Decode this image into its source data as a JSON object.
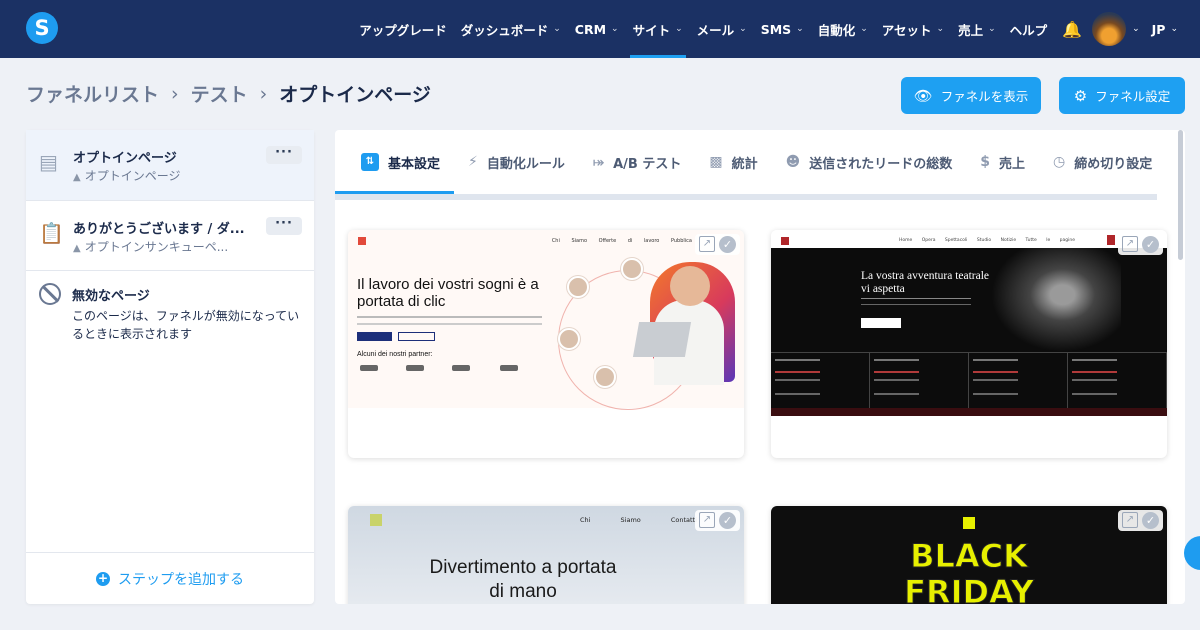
{
  "nav": {
    "items": [
      {
        "label": "アップグレード",
        "chevron": false
      },
      {
        "label": "ダッシュボード",
        "chevron": true
      },
      {
        "label": "CRM",
        "chevron": true
      },
      {
        "label": "サイト",
        "chevron": true,
        "active": true
      },
      {
        "label": "メール",
        "chevron": true
      },
      {
        "label": "SMS",
        "chevron": true
      },
      {
        "label": "自動化",
        "chevron": true
      },
      {
        "label": "アセット",
        "chevron": true
      },
      {
        "label": "売上",
        "chevron": true
      },
      {
        "label": "ヘルプ",
        "chevron": false
      }
    ],
    "logo_letter": "S",
    "language": "JP"
  },
  "breadcrumb": {
    "funnel_list": "ファネルリスト",
    "test": "テスト",
    "current": "オプトインページ"
  },
  "buttons": {
    "view_funnel": "ファネルを表示",
    "funnel_settings": "ファネル設定"
  },
  "sidebar": {
    "steps": [
      {
        "title": "オプトインページ",
        "subtitle": "オプトインページ"
      },
      {
        "title": "ありがとうございます / ダ...",
        "subtitle": "オプトインサンキューペ..."
      }
    ],
    "inactive": {
      "title": "無効なページ",
      "description": "このページは、ファネルが無効になっているときに表示されます"
    },
    "add_step": "ステップを追加する"
  },
  "tabs": [
    {
      "label": "基本設定",
      "icon": "sliders-icon",
      "active": true
    },
    {
      "label": "自動化ルール",
      "icon": "bolt-icon"
    },
    {
      "label": "A/B テスト",
      "icon": "split-icon"
    },
    {
      "label": "統計",
      "icon": "bar-chart-icon"
    },
    {
      "label": "送信されたリードの総数",
      "icon": "users-icon"
    },
    {
      "label": "売上",
      "icon": "dollar-icon"
    },
    {
      "label": "締め切り設定",
      "icon": "clock-icon"
    }
  ],
  "templates": {
    "t1": {
      "nav": "Chi Siamo Offerte di lavoro Pubblica",
      "headline": "Il lavoro dei vostri sogni è a portata di clic",
      "partners": "Alcuni dei nostri partner:"
    },
    "t2": {
      "nav": "Home Opera Spettacoli Studio Notizie Tutte le pagine",
      "headline": "La vostra avventura teatrale vi aspetta"
    },
    "t3": {
      "nav": "Chi Siamo Contatti A",
      "headline": "Divertimento a portata di mano"
    },
    "t4": {
      "headline": "BLACK FRIDAY"
    }
  },
  "colors": {
    "topbar": "#1b3164",
    "accent": "#1e9cf0"
  }
}
